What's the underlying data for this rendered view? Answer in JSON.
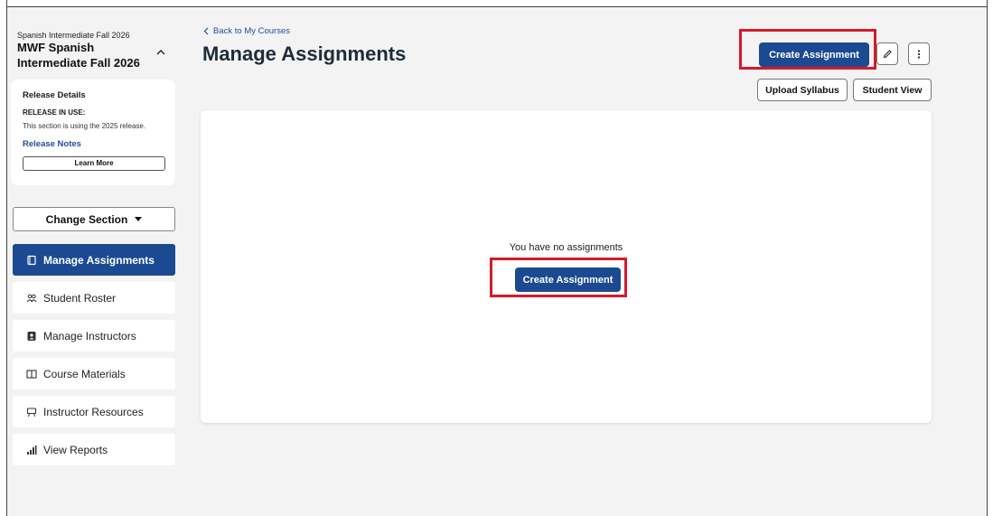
{
  "sidebar": {
    "course_subtitle": "Spanish Intermediate Fall 2026",
    "course_title": "MWF Spanish Intermediate Fall 2026",
    "release": {
      "heading": "Release Details",
      "in_use_label": "RELEASE IN USE:",
      "in_use_text": "This section is using the 2025 release.",
      "notes_link": "Release Notes",
      "learn_more": "Learn More"
    },
    "change_section": "Change Section",
    "nav": [
      {
        "label": "Manage Assignments",
        "icon": "assignment-icon",
        "active": true
      },
      {
        "label": "Student Roster",
        "icon": "people-icon",
        "active": false
      },
      {
        "label": "Manage Instructors",
        "icon": "instructor-badge-icon",
        "active": false
      },
      {
        "label": "Course Materials",
        "icon": "book-icon",
        "active": false
      },
      {
        "label": "Instructor Resources",
        "icon": "presentation-icon",
        "active": false
      },
      {
        "label": "View Reports",
        "icon": "bar-chart-icon",
        "active": false
      }
    ]
  },
  "header": {
    "back_link": "Back to My Courses",
    "title": "Manage Assignments",
    "create_button": "Create Assignment",
    "upload_syllabus": "Upload Syllabus",
    "student_view": "Student View"
  },
  "main": {
    "empty_message": "You have no assignments",
    "create_button": "Create Assignment"
  },
  "colors": {
    "primary": "#1c4a92",
    "highlight": "#d6192a",
    "link": "#1f4e9b"
  }
}
